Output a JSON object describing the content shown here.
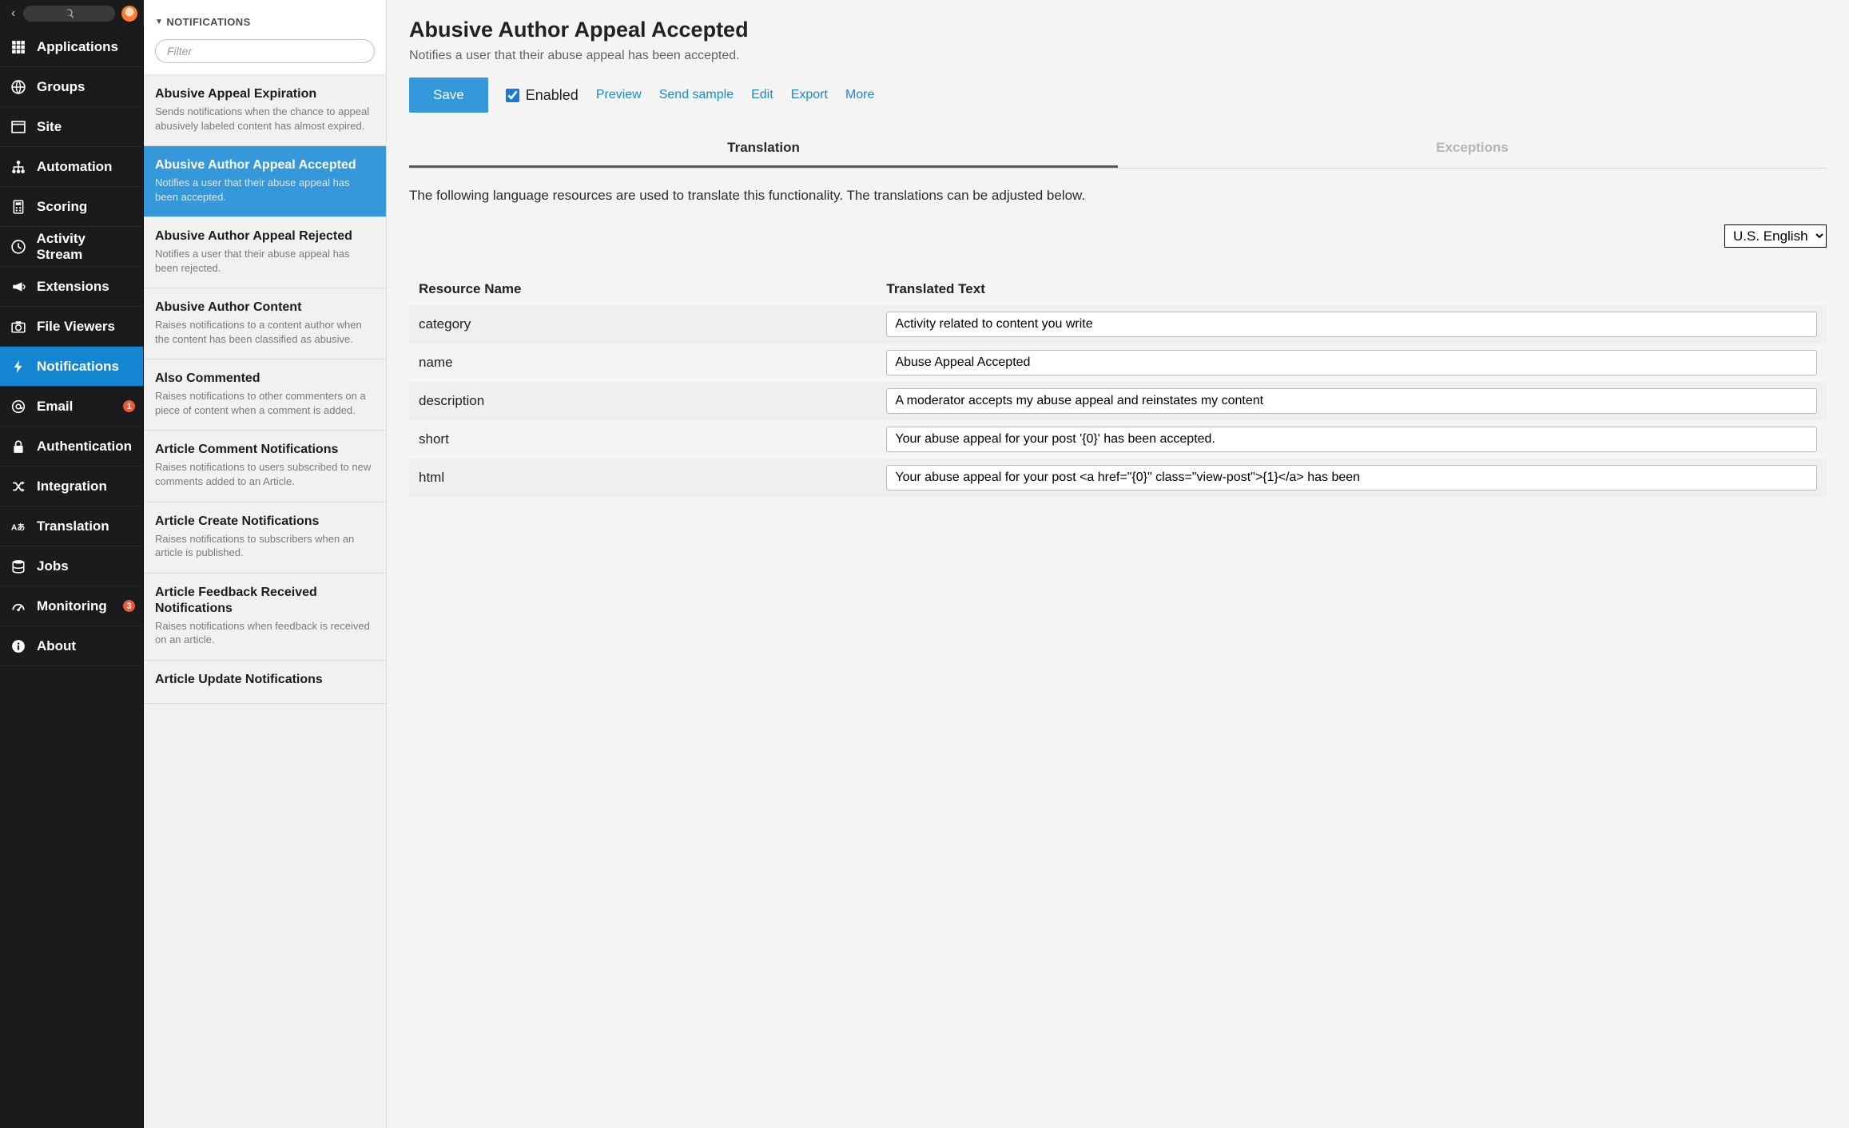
{
  "nav": {
    "items": [
      {
        "label": "Applications",
        "icon": "grid"
      },
      {
        "label": "Groups",
        "icon": "globe"
      },
      {
        "label": "Site",
        "icon": "window"
      },
      {
        "label": "Automation",
        "icon": "sitemap"
      },
      {
        "label": "Scoring",
        "icon": "calc"
      },
      {
        "label": "Activity Stream",
        "icon": "clock"
      },
      {
        "label": "Extensions",
        "icon": "megaphone"
      },
      {
        "label": "File Viewers",
        "icon": "camera"
      },
      {
        "label": "Notifications",
        "icon": "bolt",
        "active": true
      },
      {
        "label": "Email",
        "icon": "at",
        "badge": "1"
      },
      {
        "label": "Authentication",
        "icon": "lock"
      },
      {
        "label": "Integration",
        "icon": "shuffle"
      },
      {
        "label": "Translation",
        "icon": "lang"
      },
      {
        "label": "Jobs",
        "icon": "db"
      },
      {
        "label": "Monitoring",
        "icon": "gauge",
        "badge": "3"
      },
      {
        "label": "About",
        "icon": "info"
      }
    ]
  },
  "panel2": {
    "title": "NOTIFICATIONS",
    "filter_placeholder": "Filter",
    "items": [
      {
        "title": "Abusive Appeal Expiration",
        "desc": "Sends notifications when the chance to appeal abusively labeled content has almost expired."
      },
      {
        "title": "Abusive Author Appeal Accepted",
        "desc": "Notifies a user that their abuse appeal has been accepted.",
        "selected": true
      },
      {
        "title": "Abusive Author Appeal Rejected",
        "desc": "Notifies a user that their abuse appeal has been rejected."
      },
      {
        "title": "Abusive Author Content",
        "desc": "Raises notifications to a content author when the content has been classified as abusive."
      },
      {
        "title": "Also Commented",
        "desc": "Raises notifications to other commenters on a piece of content when a comment is added."
      },
      {
        "title": "Article Comment Notifications",
        "desc": "Raises notifications to users subscribed to new comments added to an Article."
      },
      {
        "title": "Article Create Notifications",
        "desc": "Raises notifications to subscribers when an article is published."
      },
      {
        "title": "Article Feedback Received Notifications",
        "desc": "Raises notifications when feedback is received on an article."
      },
      {
        "title": "Article Update Notifications",
        "desc": ""
      }
    ]
  },
  "main": {
    "title": "Abusive Author Appeal Accepted",
    "subtitle": "Notifies a user that their abuse appeal has been accepted.",
    "save_label": "Save",
    "enabled_label": "Enabled",
    "enabled_checked": true,
    "links": {
      "preview": "Preview",
      "send_sample": "Send sample",
      "edit": "Edit",
      "export": "Export",
      "more": "More"
    },
    "tabs": {
      "translation": "Translation",
      "exceptions": "Exceptions",
      "active": "translation"
    },
    "intro": "The following language resources are used to translate this functionality. The translations can be adjusted below.",
    "language_selected": "U.S. English",
    "table": {
      "head": {
        "name": "Resource Name",
        "translated": "Translated Text"
      },
      "rows": [
        {
          "name": "category",
          "value": "Activity related to content you write"
        },
        {
          "name": "name",
          "value": "Abuse Appeal Accepted"
        },
        {
          "name": "description",
          "value": "A moderator accepts my abuse appeal and reinstates my content"
        },
        {
          "name": "short",
          "value": "Your abuse appeal for your post '{0}' has been accepted."
        },
        {
          "name": "html",
          "value": "Your abuse appeal for your post <a href=\"{0}\" class=\"view-post\">{1}</a> has been"
        }
      ]
    }
  }
}
